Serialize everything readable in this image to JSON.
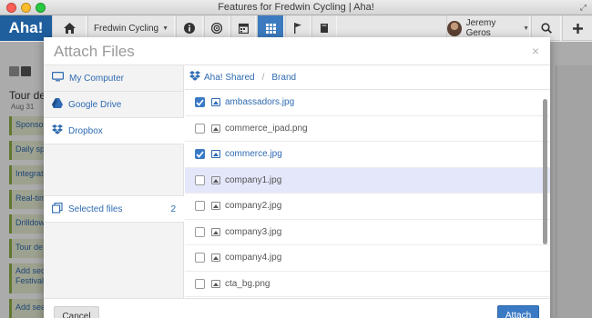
{
  "window": {
    "title": "Features for Fredwin Cycling | Aha!"
  },
  "nav": {
    "logo": "Aha!",
    "product": "Fredwin Cycling",
    "user": "Jeremy Geros",
    "icons": [
      "home-icon",
      "info-icon",
      "target-icon",
      "calendar-icon",
      "grid-icon",
      "flag-icon",
      "book-icon",
      "search-icon",
      "plus-icon"
    ]
  },
  "background_page": {
    "title": "Tour de",
    "date": "Aug 31",
    "cards": [
      "Sponsor",
      "Daily sp",
      "Integrat",
      "Real-tim",
      "Drilldow",
      "Tour de",
      "Add sect Festival t",
      "Add sear"
    ]
  },
  "modal": {
    "title": "Attach Files",
    "close": "×",
    "sources": [
      {
        "label": "My Computer",
        "icon": "computer-icon"
      },
      {
        "label": "Google Drive",
        "icon": "google-drive-icon"
      },
      {
        "label": "Dropbox",
        "icon": "dropbox-icon"
      }
    ],
    "selected_files": {
      "label": "Selected files",
      "count": "2"
    },
    "path": {
      "root": "Aha! Shared",
      "separator": "/",
      "current": "Brand"
    },
    "files": [
      {
        "name": "ambassadors.jpg",
        "checked": true
      },
      {
        "name": "commerce_ipad.png",
        "checked": false
      },
      {
        "name": "commerce.jpg",
        "checked": true
      },
      {
        "name": "company1.jpg",
        "checked": false,
        "highlighted": true
      },
      {
        "name": "company2.jpg",
        "checked": false
      },
      {
        "name": "company3.jpg",
        "checked": false
      },
      {
        "name": "company4.jpg",
        "checked": false
      },
      {
        "name": "cta_bg.png",
        "checked": false
      }
    ],
    "cancel_label": "Cancel",
    "attach_label": "Attach"
  },
  "colors": {
    "brand": "#1f5f9e",
    "accent": "#3a7ac4",
    "link": "#2e6ab1",
    "highlight_row": "#e4e6fa"
  }
}
